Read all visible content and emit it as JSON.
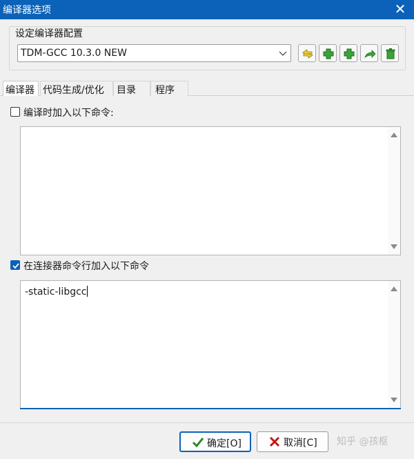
{
  "window": {
    "title": "编译器选项",
    "close_glyph": "✕"
  },
  "compiler_config": {
    "group_label": "设定编译器配置",
    "selected": "TDM-GCC 10.3.0 NEW",
    "toolbar_icons": [
      "rename-config-icon",
      "add-config-icon",
      "add-new-config-icon",
      "export-config-icon",
      "delete-config-icon"
    ]
  },
  "tabs": [
    {
      "label": "编译器",
      "selected": true
    },
    {
      "label": "代码生成/优化",
      "selected": false
    },
    {
      "label": "目录",
      "selected": false
    },
    {
      "label": "程序",
      "selected": false
    }
  ],
  "compile_cmd": {
    "label": "编译时加入以下命令:",
    "checked": false,
    "value": ""
  },
  "linker_cmd": {
    "label": "在连接器命令行加入以下命令",
    "checked": true,
    "value": "-static-libgcc"
  },
  "buttons": {
    "ok": "确定[O]",
    "cancel": "取消[C]"
  },
  "watermark": "知乎 @孩枢",
  "colors": {
    "accent": "#0b62b8",
    "ok_icon": "#2a8a2a",
    "cancel_icon": "#c01818",
    "toolbar_icon": "#3aa33a"
  }
}
